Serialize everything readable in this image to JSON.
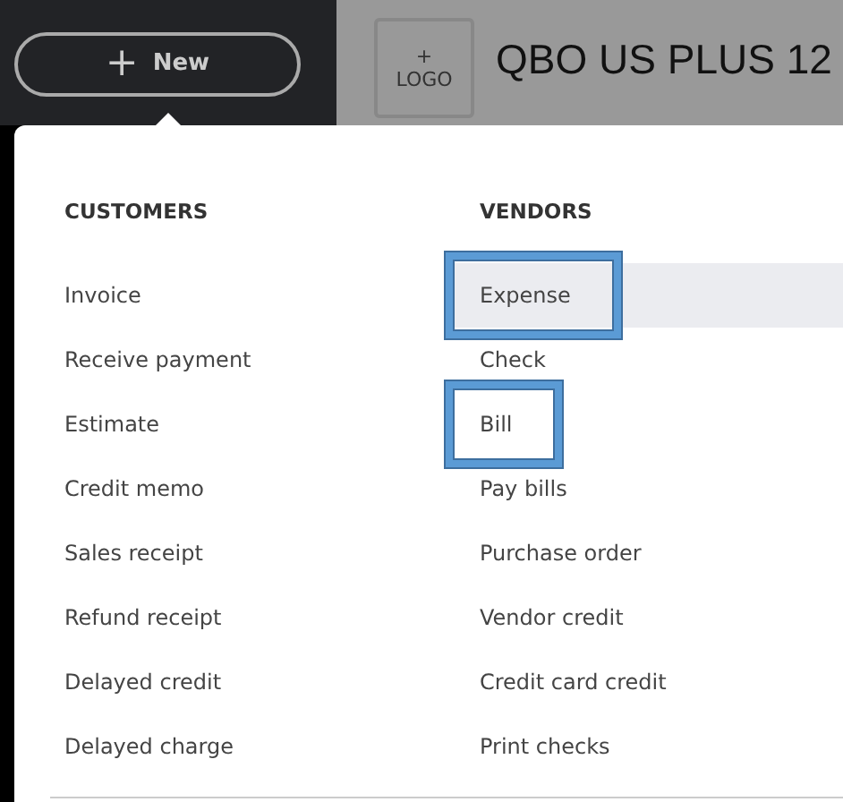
{
  "new_button": {
    "label": "New",
    "icon": "+"
  },
  "logo_placeholder": {
    "icon": "+",
    "label": "LOGO"
  },
  "company_name": "QBO US PLUS 12",
  "menu": {
    "columns": [
      {
        "heading": "CUSTOMERS",
        "items": [
          {
            "label": "Invoice",
            "hovered": false,
            "highlighted": false
          },
          {
            "label": "Receive payment",
            "hovered": false,
            "highlighted": false
          },
          {
            "label": "Estimate",
            "hovered": false,
            "highlighted": false
          },
          {
            "label": "Credit memo",
            "hovered": false,
            "highlighted": false
          },
          {
            "label": "Sales receipt",
            "hovered": false,
            "highlighted": false
          },
          {
            "label": "Refund receipt",
            "hovered": false,
            "highlighted": false
          },
          {
            "label": "Delayed credit",
            "hovered": false,
            "highlighted": false
          },
          {
            "label": "Delayed charge",
            "hovered": false,
            "highlighted": false
          }
        ]
      },
      {
        "heading": "VENDORS",
        "items": [
          {
            "label": "Expense",
            "hovered": true,
            "highlighted": true
          },
          {
            "label": "Check",
            "hovered": false,
            "highlighted": false
          },
          {
            "label": "Bill",
            "hovered": false,
            "highlighted": true
          },
          {
            "label": "Pay bills",
            "hovered": false,
            "highlighted": false
          },
          {
            "label": "Purchase order",
            "hovered": false,
            "highlighted": false
          },
          {
            "label": "Vendor credit",
            "hovered": false,
            "highlighted": false
          },
          {
            "label": "Credit card credit",
            "hovered": false,
            "highlighted": false
          },
          {
            "label": "Print checks",
            "hovered": false,
            "highlighted": false
          }
        ]
      }
    ]
  }
}
